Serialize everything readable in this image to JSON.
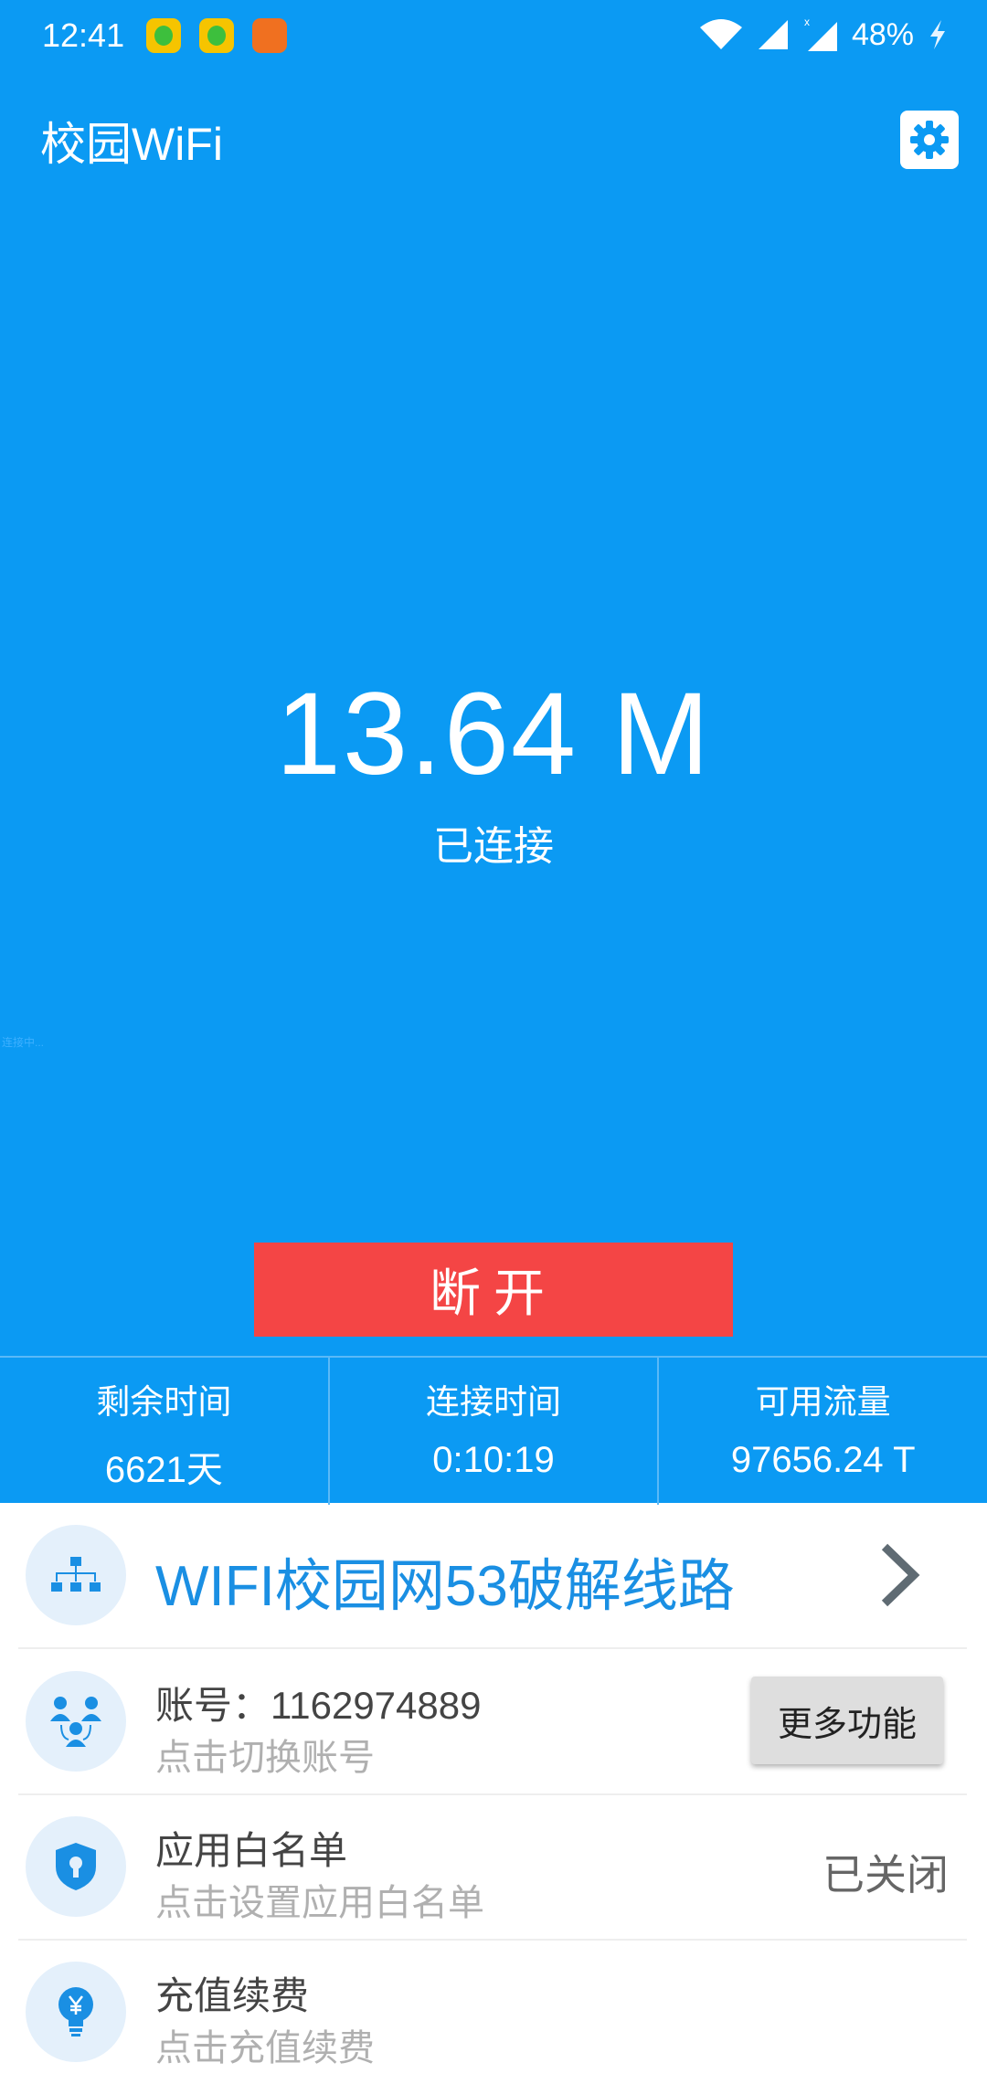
{
  "status_bar": {
    "time": "12:41",
    "battery": "48%",
    "sim_label": "x"
  },
  "header": {
    "title": "校园WiFi"
  },
  "main": {
    "speed": "13.64 M",
    "status": "已连接",
    "corner_text": "连接中..."
  },
  "disconnect_button": {
    "label": "断开"
  },
  "stats": [
    {
      "label": "剩余时间",
      "value": "6621天"
    },
    {
      "label": "连接时间",
      "value": "0:10:19"
    },
    {
      "label": "可用流量",
      "value": "97656.24 T"
    }
  ],
  "line_selector": {
    "title": "WIFI校园网53破解线路"
  },
  "account": {
    "title": "账号：1162974889",
    "subtitle": "点击切换账号",
    "button": "更多功能"
  },
  "whitelist": {
    "title": "应用白名单",
    "subtitle": "点击设置应用白名单",
    "status": "已关闭"
  },
  "recharge": {
    "title": "充值续费",
    "subtitle": "点击充值续费"
  },
  "colors": {
    "primary": "#0b9af3",
    "danger": "#f44545",
    "accent_text": "#1a8fe3"
  }
}
